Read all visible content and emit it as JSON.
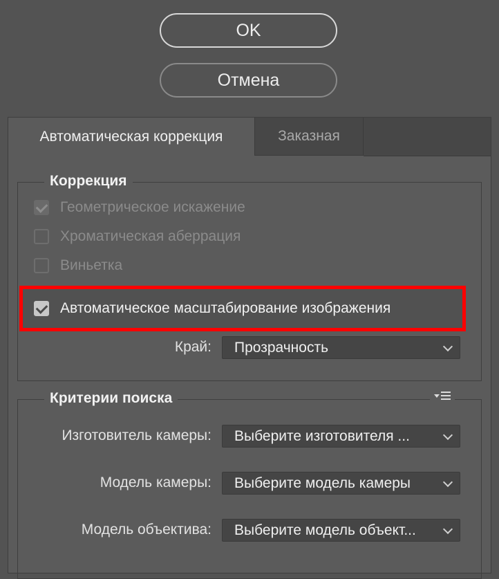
{
  "buttons": {
    "ok_label": "OK",
    "cancel_label": "Отмена"
  },
  "tabs": [
    {
      "label": "Автоматическая коррекция",
      "active": true
    },
    {
      "label": "Заказная",
      "active": false
    }
  ],
  "correction": {
    "title": "Коррекция",
    "items": [
      {
        "label": "Геометрическое искажение",
        "checked": true,
        "enabled": false
      },
      {
        "label": "Хроматическая аберрация",
        "checked": false,
        "enabled": false
      },
      {
        "label": "Виньетка",
        "checked": false,
        "enabled": false
      },
      {
        "label": "Автоматическое масштабирование изображения",
        "checked": true,
        "enabled": true
      }
    ],
    "edge_label": "Край:",
    "edge_value": "Прозрачность"
  },
  "search": {
    "title": "Критерии поиска",
    "camera_maker_label": "Изготовитель камеры:",
    "camera_maker_value": "Выберите изготовителя ...",
    "camera_model_label": "Модель камеры:",
    "camera_model_value": "Выберите модель камеры",
    "lens_model_label": "Модель объектива:",
    "lens_model_value": "Выберите модель объект..."
  },
  "colors": {
    "highlight": "#ff0000",
    "background": "#535353"
  }
}
